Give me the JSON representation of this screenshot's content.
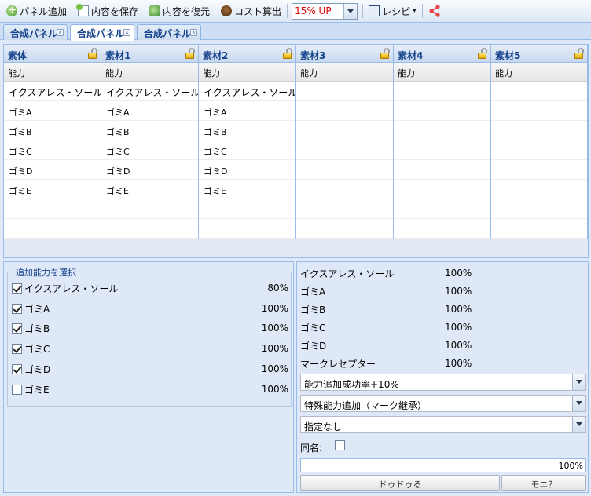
{
  "toolbar": {
    "add_panel": "パネル追加",
    "save_content": "内容を保存",
    "restore_content": "内容を復元",
    "cost_calc": "コスト算出",
    "rate_value": "15% UP",
    "recipe": "レシピ",
    "recipe_arrow": "▾"
  },
  "tabs": [
    {
      "label": "合成パネル",
      "close": "x"
    },
    {
      "label": "合成パネル",
      "close": "x"
    },
    {
      "label": "合成パネル",
      "close": "x"
    }
  ],
  "grid": {
    "columns": [
      {
        "header": "素体",
        "sub": "能力",
        "cells": [
          "イクスアレス・ソール",
          "ゴミA",
          "ゴミB",
          "ゴミC",
          "ゴミD",
          "ゴミE"
        ]
      },
      {
        "header": "素材1",
        "sub": "能力",
        "cells": [
          "イクスアレス・ソール",
          "ゴミA",
          "ゴミB",
          "ゴミC",
          "ゴミD",
          "ゴミE"
        ]
      },
      {
        "header": "素材2",
        "sub": "能力",
        "cells": [
          "イクスアレス・ソール",
          "ゴミA",
          "ゴミB",
          "ゴミC",
          "ゴミD",
          "ゴミE"
        ]
      },
      {
        "header": "素材3",
        "sub": "能力",
        "cells": [
          "",
          "",
          "",
          "",
          "",
          ""
        ]
      },
      {
        "header": "素材4",
        "sub": "能力",
        "cells": [
          "",
          "",
          "",
          "",
          "",
          ""
        ]
      },
      {
        "header": "素材5",
        "sub": "能力",
        "cells": [
          "",
          "",
          "",
          "",
          "",
          ""
        ]
      }
    ]
  },
  "ability_select": {
    "legend": "追加能力を選択",
    "items": [
      {
        "name": "イクスアレス・ソール",
        "pct": "80%",
        "checked": true
      },
      {
        "name": "ゴミA",
        "pct": "100%",
        "checked": true
      },
      {
        "name": "ゴミB",
        "pct": "100%",
        "checked": true
      },
      {
        "name": "ゴミC",
        "pct": "100%",
        "checked": true
      },
      {
        "name": "ゴミD",
        "pct": "100%",
        "checked": true
      },
      {
        "name": "ゴミE",
        "pct": "100%",
        "checked": false
      }
    ]
  },
  "results": {
    "items": [
      {
        "name": "イクスアレス・ソール",
        "pct": "100%"
      },
      {
        "name": "ゴミA",
        "pct": "100%"
      },
      {
        "name": "ゴミB",
        "pct": "100%"
      },
      {
        "name": "ゴミC",
        "pct": "100%"
      },
      {
        "name": "ゴミD",
        "pct": "100%"
      },
      {
        "name": "マークレセプター",
        "pct": "100%"
      }
    ],
    "combo1": "能力追加成功率+10%",
    "combo2": "特殊能力追加（マーク継承）",
    "combo3": "指定なし",
    "same_name_label": "同名:",
    "progress_text": "100%",
    "progress_fraction": 1.0,
    "button_main": "ドゥドゥる",
    "button_moni": "モニ？"
  },
  "colors": {
    "share_icon": "#e8474c",
    "rate_text": "#e00000",
    "header_text": "#15428b"
  }
}
